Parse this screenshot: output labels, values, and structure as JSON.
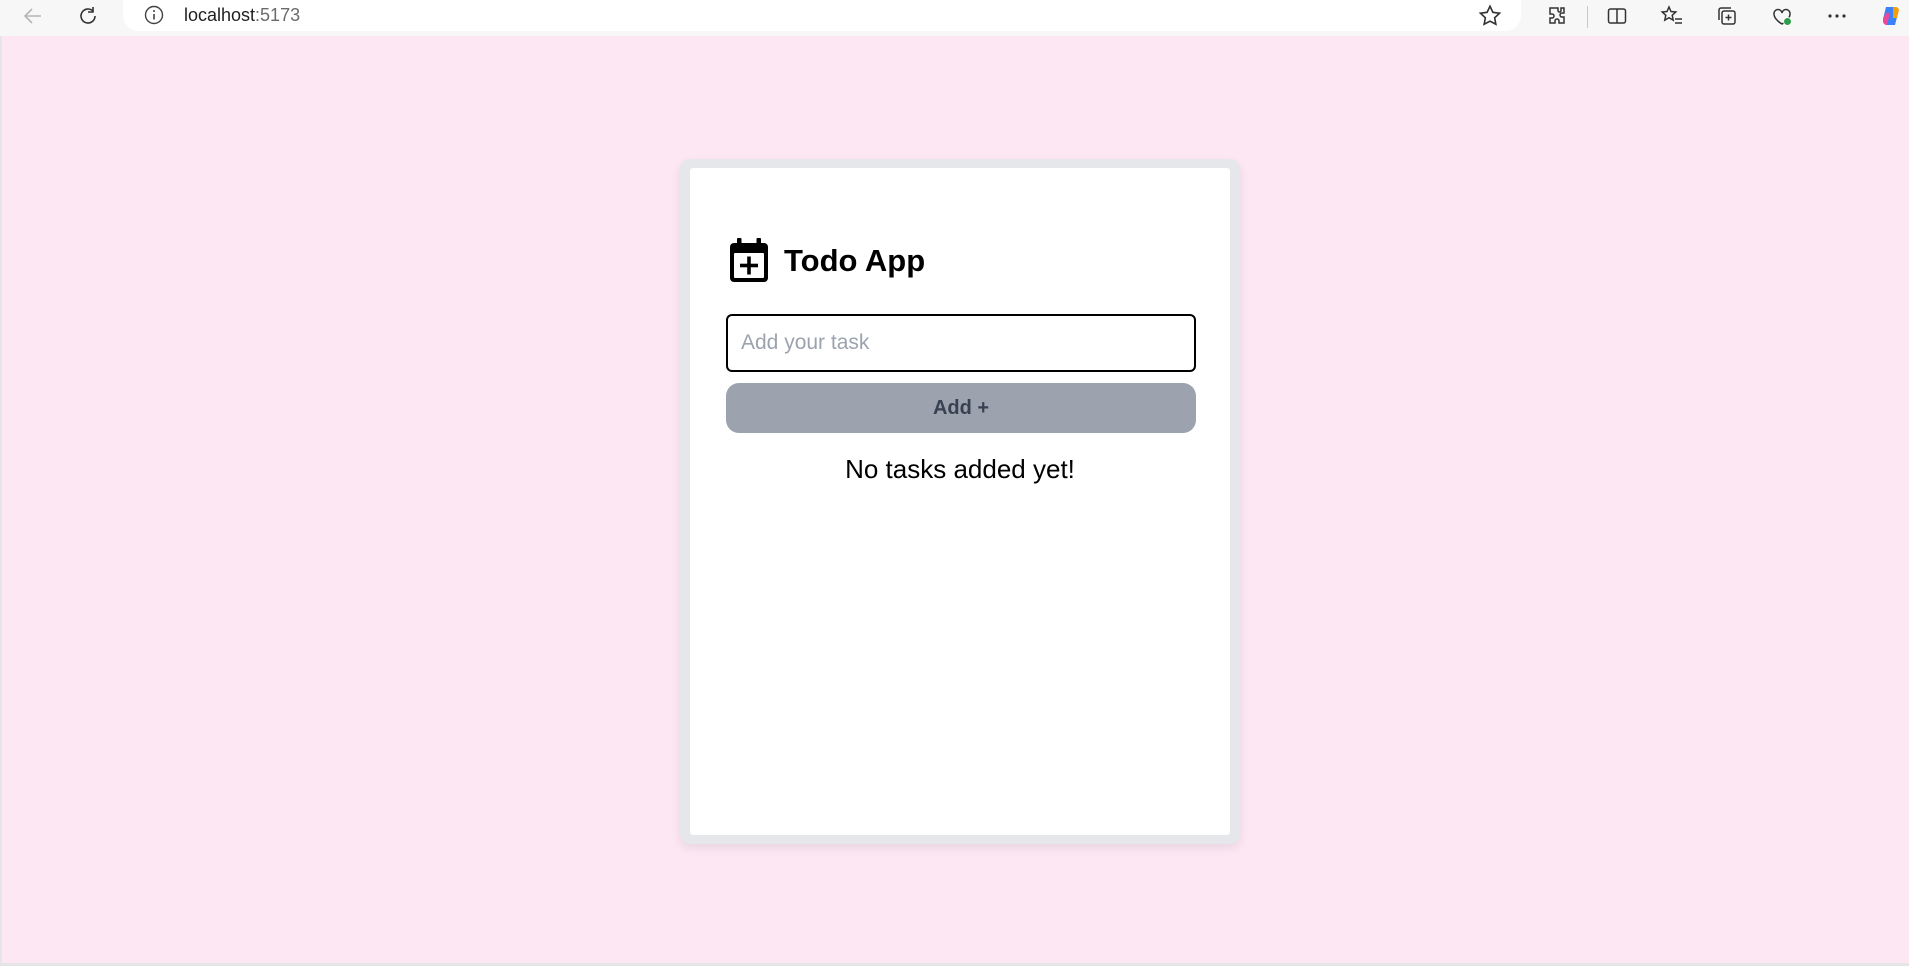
{
  "browser": {
    "url_host": "localhost",
    "url_port": ":5173",
    "icons": [
      "back-icon",
      "refresh-icon",
      "site-info-icon",
      "favorite-star-icon",
      "extensions-icon",
      "split-screen-icon",
      "favorites-icon",
      "collections-icon",
      "browser-essentials-icon",
      "more-options-icon",
      "copilot-icon"
    ]
  },
  "app": {
    "title": "Todo App",
    "title_icon": "calendar-plus-icon",
    "input_placeholder": "Add your task",
    "input_value": "",
    "add_button_label": "Add +",
    "empty_message": "No tasks added yet!"
  },
  "colors": {
    "page_background": "#fce7f3",
    "card_border": "#e5e7eb",
    "card_background": "#ffffff",
    "button_background": "#9ca3af",
    "button_text": "#374151"
  }
}
